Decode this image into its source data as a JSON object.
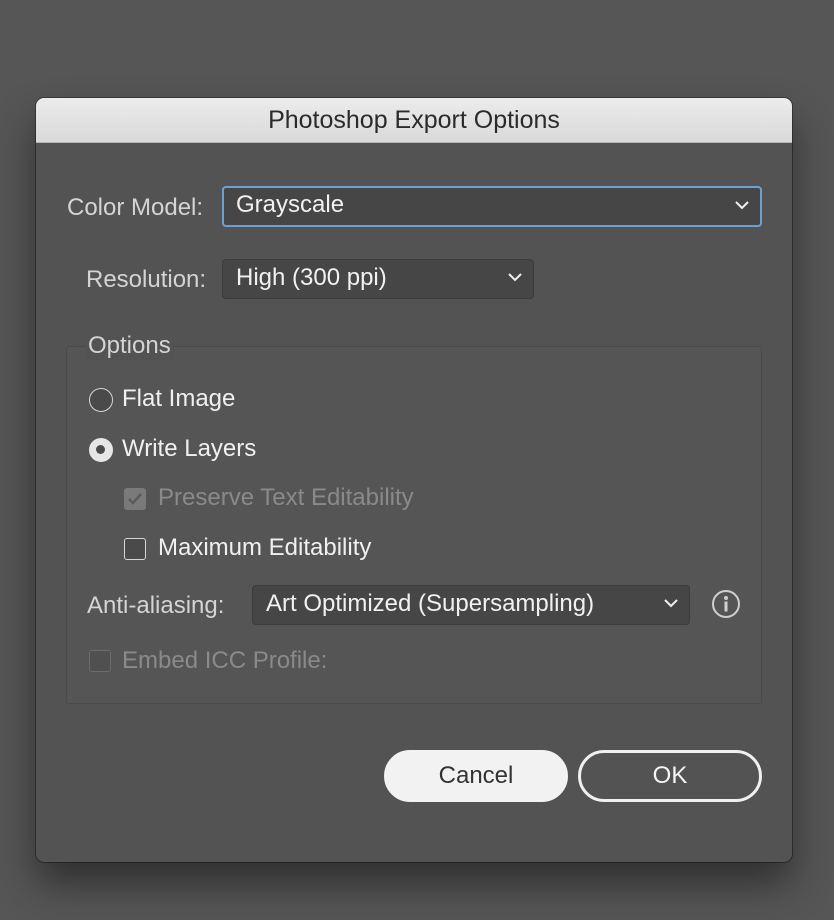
{
  "dialog": {
    "title": "Photoshop Export Options"
  },
  "color_model": {
    "label": "Color Model:",
    "value": "Grayscale"
  },
  "resolution": {
    "label": "Resolution:",
    "value": "High (300 ppi)"
  },
  "options": {
    "title": "Options",
    "flat_image": {
      "label": "Flat Image",
      "selected": false
    },
    "write_layers": {
      "label": "Write Layers",
      "selected": true
    },
    "preserve_text": {
      "label": "Preserve Text Editability",
      "checked": true,
      "enabled": false
    },
    "max_edit": {
      "label": "Maximum Editability",
      "checked": false,
      "enabled": true
    },
    "antialiasing": {
      "label": "Anti-aliasing:",
      "value": "Art Optimized (Supersampling)"
    },
    "embed_icc": {
      "label": "Embed ICC Profile:",
      "checked": false,
      "enabled": false
    }
  },
  "buttons": {
    "cancel": "Cancel",
    "ok": "OK"
  },
  "icons": {
    "dropdown": "chevron-down-icon",
    "info": "info-icon"
  },
  "colors": {
    "focus_ring": "#6e9fd6",
    "dialog_bg": "#535353",
    "titlebar": "#e2e2e2"
  }
}
